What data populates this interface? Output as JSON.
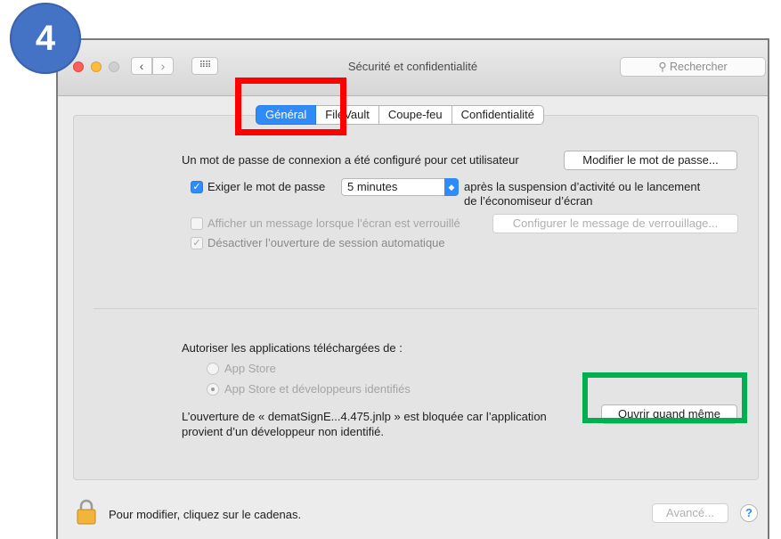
{
  "badge": {
    "number": "4"
  },
  "window": {
    "title": "Sécurité et confidentialité",
    "search_placeholder": "Rechercher"
  },
  "tabs": [
    {
      "label": "Général",
      "selected": true
    },
    {
      "label": "FileVault",
      "selected": false
    },
    {
      "label": "Coupe-feu",
      "selected": false
    },
    {
      "label": "Confidentialité",
      "selected": false
    }
  ],
  "general": {
    "password_text": "Un mot de passe de connexion a été configuré pour cet utilisateur",
    "change_password_button": "Modifier le mot de passe...",
    "require_password_label": "Exiger le mot de passe",
    "require_password_checked": true,
    "delay_value": "5 minutes",
    "after_text_line1": "après la suspension d’activité ou le lancement",
    "after_text_line2": "de l’économiseur d’écran",
    "show_message_label": "Afficher un message lorsque l’écran est verrouillé",
    "show_message_checked": false,
    "set_message_button": "Configurer le message de verrouillage...",
    "disable_autologin_label": "Désactiver l’ouverture de session automatique",
    "disable_autologin_checked": true
  },
  "downloads": {
    "heading": "Autoriser les applications téléchargées de :",
    "options": [
      {
        "label": "App Store",
        "selected": false
      },
      {
        "label": "App Store et développeurs identifiés",
        "selected": true
      }
    ],
    "blocked_line1": "L’ouverture de « dematSignE...4.475.jnlp » est bloquée car l’application",
    "blocked_line2": "provient d’un développeur non identifié.",
    "open_anyway_button": "Ouvrir quand même"
  },
  "footer": {
    "lock_text": "Pour modifier, cliquez sur le cadenas.",
    "advanced_button": "Avancé...",
    "help_label": "?"
  },
  "colors": {
    "accent": "#2f8bf8",
    "badge": "#4472c4",
    "highlight_red": "#ff0000",
    "highlight_green": "#00b050"
  }
}
